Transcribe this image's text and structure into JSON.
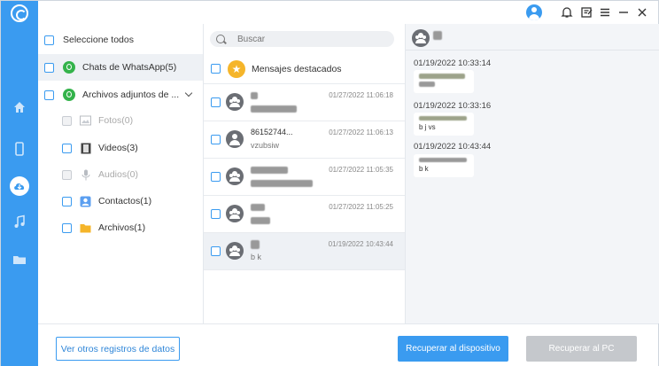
{
  "colors": {
    "accent": "#3a9bf0",
    "whatsapp": "#34b34b",
    "star": "#f5b52a",
    "disabled": "#c5c8cc"
  },
  "rail": {
    "icons": [
      "app-logo-icon",
      "home-icon",
      "phone-icon",
      "cloud-icon",
      "music-icon",
      "folder-icon"
    ],
    "active": "cloud-icon"
  },
  "titlebar": {
    "icons": [
      "account-icon",
      "bell-icon",
      "feedback-icon",
      "menu-icon",
      "minimize-icon",
      "close-icon"
    ]
  },
  "column1": {
    "select_all": "Seleccione todos",
    "whatsapp_chats": "Chats de WhatsApp(5)",
    "attachments": "Archivos adjuntos de ...",
    "sub_items": [
      {
        "label": "Fotos(0)",
        "enabled": false
      },
      {
        "label": "Videos(3)",
        "enabled": true
      },
      {
        "label": "Audios(0)",
        "enabled": false
      },
      {
        "label": "Contactos(1)",
        "enabled": true
      },
      {
        "label": "Archivos(1)",
        "enabled": true
      }
    ]
  },
  "column2": {
    "search_placeholder": "Buscar",
    "featured": "Mensajes destacados",
    "chats": [
      {
        "name": "",
        "preview": "",
        "time": "01/27/2022 11:06:18"
      },
      {
        "name": "86152744...",
        "preview": "vzubsiw",
        "time": "01/27/2022 11:06:13"
      },
      {
        "name": "",
        "preview": "",
        "time": "01/27/2022 11:05:35"
      },
      {
        "name": "",
        "preview": "",
        "time": "01/27/2022 11:05:25"
      },
      {
        "name": "",
        "preview": "b k",
        "time": "01/19/2022 10:43:44"
      }
    ]
  },
  "column3": {
    "messages": [
      {
        "time": "01/19/2022 10:33:14",
        "text": ""
      },
      {
        "time": "01/19/2022 10:33:16",
        "text": "b j vs"
      },
      {
        "time": "01/19/2022 10:43:44",
        "text": "b k"
      }
    ]
  },
  "buttons": {
    "other_records": "Ver otros registros de datos",
    "recover_device": "Recuperar al dispositivo",
    "recover_pc": "Recuperar al PC"
  }
}
